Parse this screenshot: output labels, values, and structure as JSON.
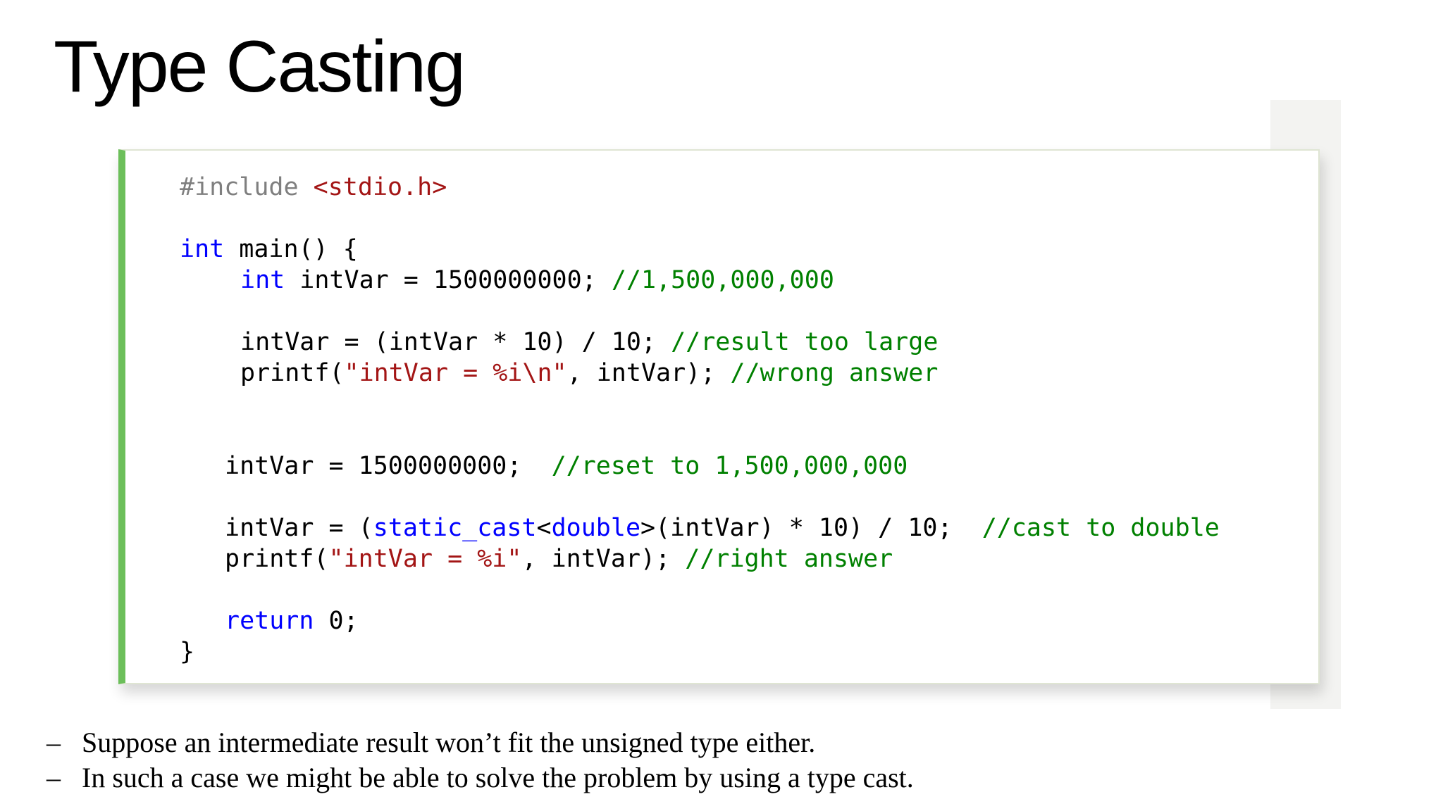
{
  "title": "Type Casting",
  "code": {
    "l1": {
      "a": "#include",
      "b": " ",
      "c": "<stdio.h>"
    },
    "l2": {
      "a": "int",
      "b": " main() {"
    },
    "l3": {
      "a": "int",
      "b": " intVar = 1500000000; ",
      "c": "//1,500,000,000"
    },
    "l4": {
      "a": "intVar = (intVar * 10) / 10; ",
      "b": "//result too large"
    },
    "l5": {
      "a": "printf(",
      "b": "\"intVar = %i\\n\"",
      "c": ", intVar); ",
      "d": "//wrong answer"
    },
    "l6": {
      "a": "intVar = 1500000000;  ",
      "b": "//reset to 1,500,000,000"
    },
    "l7": {
      "a": "intVar = (",
      "b": "static_cast",
      "c": "<",
      "d": "double",
      "e": ">(intVar) * 10) / 10;  ",
      "f": "//cast to double"
    },
    "l8": {
      "a": "printf(",
      "b": "\"intVar = %i\"",
      "c": ", intVar); ",
      "d": "//right answer"
    },
    "l9": {
      "a": "return",
      "b": " 0;"
    },
    "l10": {
      "a": "}"
    }
  },
  "bullets": [
    {
      "marker": "–",
      "text": "Suppose an intermediate result won’t fit the unsigned type either."
    },
    {
      "marker": "–",
      "text": "In such a case we might be able to solve the problem by using a type cast."
    }
  ]
}
